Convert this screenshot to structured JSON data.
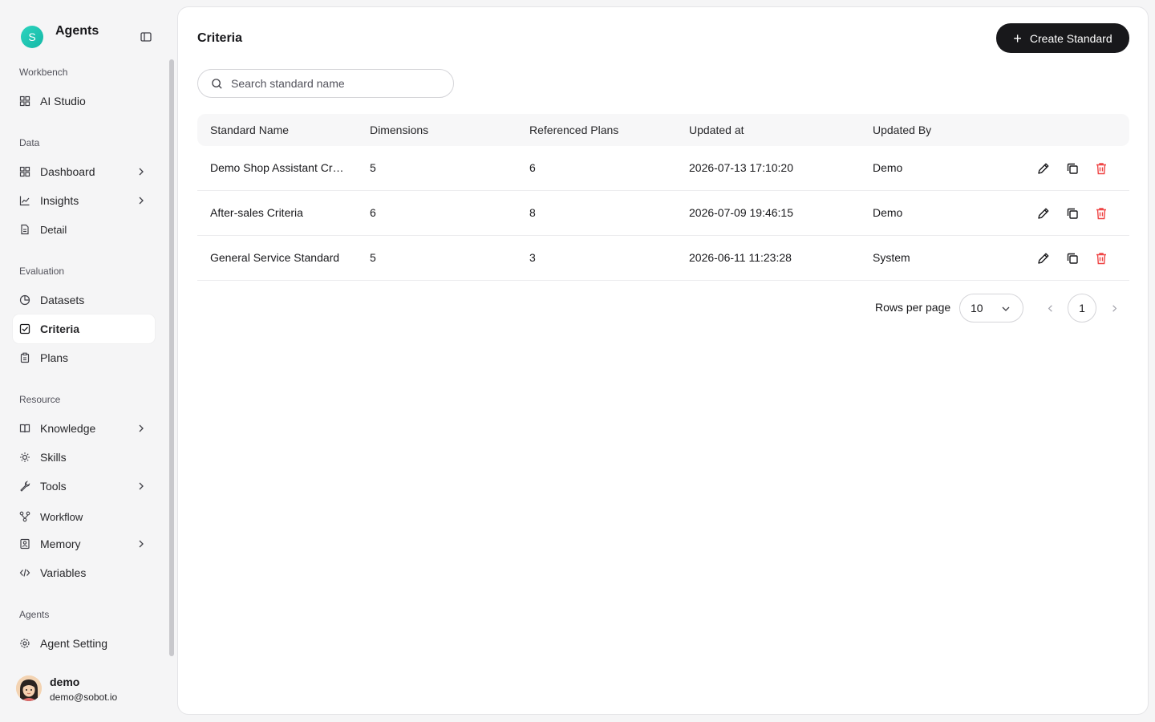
{
  "brand": {
    "logo_letter": "S",
    "name": "Agents"
  },
  "sidebar": {
    "sections": {
      "workbench": "Workbench",
      "data": "Data",
      "evaluation": "Evaluation",
      "resource": "Resource",
      "agents": "Agents"
    },
    "items": {
      "ai_studio": "AI Studio",
      "dashboard": "Dashboard",
      "insights": "Insights",
      "detail": "Detail",
      "datasets": "Datasets",
      "criteria": "Criteria",
      "plans": "Plans",
      "knowledge": "Knowledge",
      "skills": "Skills",
      "tools": "Tools",
      "workflow": "Workflow",
      "memory": "Memory",
      "variables": "Variables",
      "agent_setting": "Agent Setting"
    },
    "active_item": "Criteria"
  },
  "user": {
    "name": "demo",
    "email": "demo@sobot.io"
  },
  "main": {
    "title": "Criteria",
    "create_button": "Create Standard",
    "search_placeholder": "Search standard name",
    "table": {
      "headers": [
        "Standard Name",
        "Dimensions",
        "Referenced Plans",
        "Updated at",
        "Updated By"
      ],
      "rows": [
        [
          "Demo Shop Assistant Criteria",
          "5",
          "6",
          "2026-07-13 17:10:20",
          "Demo"
        ],
        [
          "After-sales Criteria",
          "6",
          "8",
          "2026-07-09 19:46:15",
          "Demo"
        ],
        [
          "General Service Standard",
          "5",
          "3",
          "2026-06-11 11:23:28",
          "System"
        ]
      ]
    },
    "pagination": {
      "rows_per_page_label": "Rows per page",
      "rows_per_page": "10",
      "current_page": "1"
    }
  },
  "colors": {
    "accent": "#18181b",
    "delete": "#ef4444",
    "brand": "#14b8a6"
  }
}
